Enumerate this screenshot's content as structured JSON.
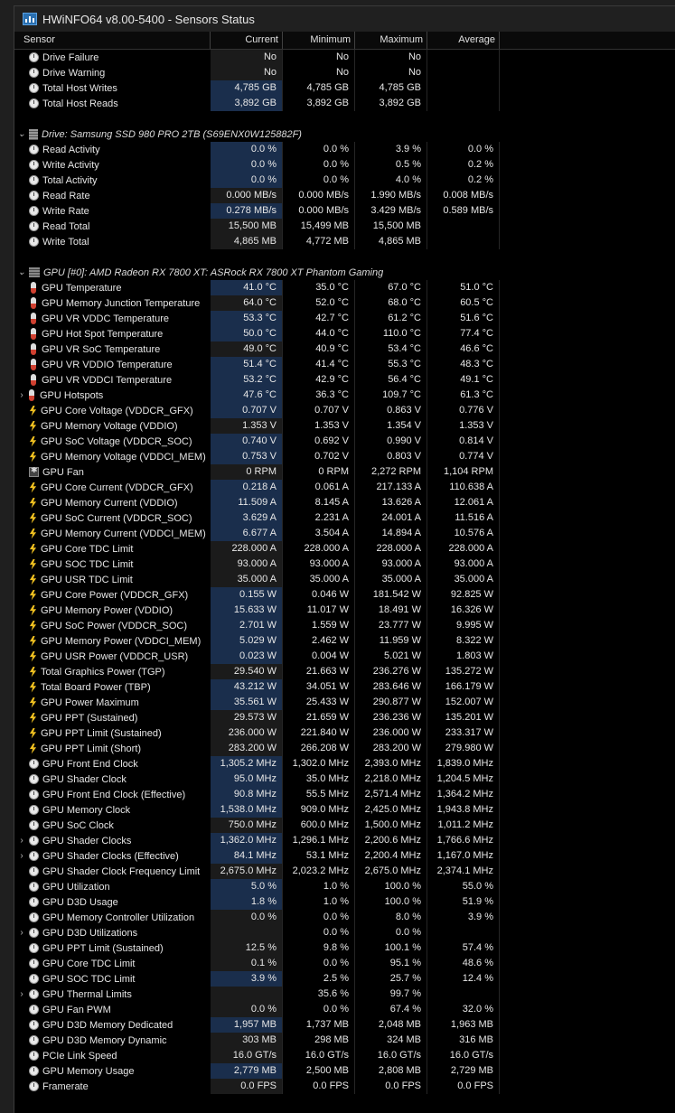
{
  "window": {
    "title": "HWiNFO64 v8.00-5400 - Sensors Status"
  },
  "columns": [
    "Sensor",
    "Current",
    "Minimum",
    "Maximum",
    "Average"
  ],
  "top_rows": [
    {
      "icon": "clock-icon",
      "label": "Drive Failure",
      "cur": "No",
      "min": "No",
      "max": "No",
      "avg": "",
      "hl": false
    },
    {
      "icon": "clock-icon",
      "label": "Drive Warning",
      "cur": "No",
      "min": "No",
      "max": "No",
      "avg": "",
      "hl": false
    },
    {
      "icon": "clock-icon",
      "label": "Total Host Writes",
      "cur": "4,785 GB",
      "min": "4,785 GB",
      "max": "4,785 GB",
      "avg": "",
      "hl": true
    },
    {
      "icon": "clock-icon",
      "label": "Total Host Reads",
      "cur": "3,892 GB",
      "min": "3,892 GB",
      "max": "3,892 GB",
      "avg": "",
      "hl": true
    }
  ],
  "drive_group": {
    "label": "Drive: Samsung SSD 980 PRO 2TB (S69ENX0W125882F)"
  },
  "drive_rows": [
    {
      "icon": "clock-icon",
      "label": "Read Activity",
      "cur": "0.0 %",
      "min": "0.0 %",
      "max": "3.9 %",
      "avg": "0.0 %",
      "hl": true
    },
    {
      "icon": "clock-icon",
      "label": "Write Activity",
      "cur": "0.0 %",
      "min": "0.0 %",
      "max": "0.5 %",
      "avg": "0.2 %",
      "hl": true
    },
    {
      "icon": "clock-icon",
      "label": "Total Activity",
      "cur": "0.0 %",
      "min": "0.0 %",
      "max": "4.0 %",
      "avg": "0.2 %",
      "hl": true
    },
    {
      "icon": "clock-icon",
      "label": "Read Rate",
      "cur": "0.000 MB/s",
      "min": "0.000 MB/s",
      "max": "1.990 MB/s",
      "avg": "0.008 MB/s",
      "hl": false
    },
    {
      "icon": "clock-icon",
      "label": "Write Rate",
      "cur": "0.278 MB/s",
      "min": "0.000 MB/s",
      "max": "3.429 MB/s",
      "avg": "0.589 MB/s",
      "hl": true
    },
    {
      "icon": "clock-icon",
      "label": "Read Total",
      "cur": "15,500 MB",
      "min": "15,499 MB",
      "max": "15,500 MB",
      "avg": "",
      "hl": false
    },
    {
      "icon": "clock-icon",
      "label": "Write Total",
      "cur": "4,865 MB",
      "min": "4,772 MB",
      "max": "4,865 MB",
      "avg": "",
      "hl": false
    }
  ],
  "gpu_group": {
    "label": "GPU [#0]: AMD Radeon RX 7800 XT: ASRock RX 7800 XT Phantom Gaming"
  },
  "gpu_rows": [
    {
      "icon": "thermometer-icon",
      "label": "GPU Temperature",
      "cur": "41.0 °C",
      "min": "35.0 °C",
      "max": "67.0 °C",
      "avg": "51.0 °C",
      "hl": true
    },
    {
      "icon": "thermometer-icon",
      "label": "GPU Memory Junction Temperature",
      "cur": "64.0 °C",
      "min": "52.0 °C",
      "max": "68.0 °C",
      "avg": "60.5 °C",
      "hl": false
    },
    {
      "icon": "thermometer-icon",
      "label": "GPU VR VDDC Temperature",
      "cur": "53.3 °C",
      "min": "42.7 °C",
      "max": "61.2 °C",
      "avg": "51.6 °C",
      "hl": true
    },
    {
      "icon": "thermometer-icon",
      "label": "GPU Hot Spot Temperature",
      "cur": "50.0 °C",
      "min": "44.0 °C",
      "max": "110.0 °C",
      "avg": "77.4 °C",
      "hl": true
    },
    {
      "icon": "thermometer-icon",
      "label": "GPU VR SoC Temperature",
      "cur": "49.0 °C",
      "min": "40.9 °C",
      "max": "53.4 °C",
      "avg": "46.6 °C",
      "hl": false
    },
    {
      "icon": "thermometer-icon",
      "label": "GPU VR VDDIO Temperature",
      "cur": "51.4 °C",
      "min": "41.4 °C",
      "max": "55.3 °C",
      "avg": "48.3 °C",
      "hl": true
    },
    {
      "icon": "thermometer-icon",
      "label": "GPU VR VDDCI Temperature",
      "cur": "53.2 °C",
      "min": "42.9 °C",
      "max": "56.4 °C",
      "avg": "49.1 °C",
      "hl": true
    },
    {
      "icon": "thermometer-icon",
      "label": "GPU Hotspots",
      "cur": "47.6 °C",
      "min": "36.3 °C",
      "max": "109.7 °C",
      "avg": "61.3 °C",
      "hl": true,
      "expand": true
    },
    {
      "icon": "voltage-icon",
      "label": "GPU Core Voltage (VDDCR_GFX)",
      "cur": "0.707 V",
      "min": "0.707 V",
      "max": "0.863 V",
      "avg": "0.776 V",
      "hl": true
    },
    {
      "icon": "voltage-icon",
      "label": "GPU Memory Voltage (VDDIO)",
      "cur": "1.353 V",
      "min": "1.353 V",
      "max": "1.354 V",
      "avg": "1.353 V",
      "hl": false
    },
    {
      "icon": "voltage-icon",
      "label": "GPU SoC Voltage (VDDCR_SOC)",
      "cur": "0.740 V",
      "min": "0.692 V",
      "max": "0.990 V",
      "avg": "0.814 V",
      "hl": true
    },
    {
      "icon": "voltage-icon",
      "label": "GPU Memory Voltage (VDDCI_MEM)",
      "cur": "0.753 V",
      "min": "0.702 V",
      "max": "0.803 V",
      "avg": "0.774 V",
      "hl": true
    },
    {
      "icon": "fan-icon",
      "label": "GPU Fan",
      "cur": "0 RPM",
      "min": "0 RPM",
      "max": "2,272 RPM",
      "avg": "1,104 RPM",
      "hl": false
    },
    {
      "icon": "voltage-icon",
      "label": "GPU Core Current (VDDCR_GFX)",
      "cur": "0.218 A",
      "min": "0.061 A",
      "max": "217.133 A",
      "avg": "110.638 A",
      "hl": true
    },
    {
      "icon": "voltage-icon",
      "label": "GPU Memory Current (VDDIO)",
      "cur": "11.509 A",
      "min": "8.145 A",
      "max": "13.626 A",
      "avg": "12.061 A",
      "hl": true
    },
    {
      "icon": "voltage-icon",
      "label": "GPU SoC Current (VDDCR_SOC)",
      "cur": "3.629 A",
      "min": "2.231 A",
      "max": "24.001 A",
      "avg": "11.516 A",
      "hl": true
    },
    {
      "icon": "voltage-icon",
      "label": "GPU Memory Current (VDDCI_MEM)",
      "cur": "6.677 A",
      "min": "3.504 A",
      "max": "14.894 A",
      "avg": "10.576 A",
      "hl": true
    },
    {
      "icon": "voltage-icon",
      "label": "GPU Core TDC Limit",
      "cur": "228.000 A",
      "min": "228.000 A",
      "max": "228.000 A",
      "avg": "228.000 A",
      "hl": false
    },
    {
      "icon": "voltage-icon",
      "label": "GPU SOC TDC Limit",
      "cur": "93.000 A",
      "min": "93.000 A",
      "max": "93.000 A",
      "avg": "93.000 A",
      "hl": false
    },
    {
      "icon": "voltage-icon",
      "label": "GPU USR TDC Limit",
      "cur": "35.000 A",
      "min": "35.000 A",
      "max": "35.000 A",
      "avg": "35.000 A",
      "hl": false
    },
    {
      "icon": "voltage-icon",
      "label": "GPU Core Power (VDDCR_GFX)",
      "cur": "0.155 W",
      "min": "0.046 W",
      "max": "181.542 W",
      "avg": "92.825 W",
      "hl": true
    },
    {
      "icon": "voltage-icon",
      "label": "GPU Memory Power (VDDIO)",
      "cur": "15.633 W",
      "min": "11.017 W",
      "max": "18.491 W",
      "avg": "16.326 W",
      "hl": true
    },
    {
      "icon": "voltage-icon",
      "label": "GPU SoC Power (VDDCR_SOC)",
      "cur": "2.701 W",
      "min": "1.559 W",
      "max": "23.777 W",
      "avg": "9.995 W",
      "hl": true
    },
    {
      "icon": "voltage-icon",
      "label": "GPU Memory Power (VDDCI_MEM)",
      "cur": "5.029 W",
      "min": "2.462 W",
      "max": "11.959 W",
      "avg": "8.322 W",
      "hl": true
    },
    {
      "icon": "voltage-icon",
      "label": "GPU USR Power (VDDCR_USR)",
      "cur": "0.023 W",
      "min": "0.004 W",
      "max": "5.021 W",
      "avg": "1.803 W",
      "hl": true
    },
    {
      "icon": "voltage-icon",
      "label": "Total Graphics Power (TGP)",
      "cur": "29.540 W",
      "min": "21.663 W",
      "max": "236.276 W",
      "avg": "135.272 W",
      "hl": false
    },
    {
      "icon": "voltage-icon",
      "label": "Total Board Power (TBP)",
      "cur": "43.212 W",
      "min": "34.051 W",
      "max": "283.646 W",
      "avg": "166.179 W",
      "hl": true
    },
    {
      "icon": "voltage-icon",
      "label": "GPU Power Maximum",
      "cur": "35.561 W",
      "min": "25.433 W",
      "max": "290.877 W",
      "avg": "152.007 W",
      "hl": true
    },
    {
      "icon": "voltage-icon",
      "label": "GPU PPT (Sustained)",
      "cur": "29.573 W",
      "min": "21.659 W",
      "max": "236.236 W",
      "avg": "135.201 W",
      "hl": false
    },
    {
      "icon": "voltage-icon",
      "label": "GPU PPT Limit (Sustained)",
      "cur": "236.000 W",
      "min": "221.840 W",
      "max": "236.000 W",
      "avg": "233.317 W",
      "hl": false
    },
    {
      "icon": "voltage-icon",
      "label": "GPU PPT Limit (Short)",
      "cur": "283.200 W",
      "min": "266.208 W",
      "max": "283.200 W",
      "avg": "279.980 W",
      "hl": false
    },
    {
      "icon": "clock-icon",
      "label": "GPU Front End Clock",
      "cur": "1,305.2 MHz",
      "min": "1,302.0 MHz",
      "max": "2,393.0 MHz",
      "avg": "1,839.0 MHz",
      "hl": true
    },
    {
      "icon": "clock-icon",
      "label": "GPU Shader Clock",
      "cur": "95.0 MHz",
      "min": "35.0 MHz",
      "max": "2,218.0 MHz",
      "avg": "1,204.5 MHz",
      "hl": true
    },
    {
      "icon": "clock-icon",
      "label": "GPU Front End Clock (Effective)",
      "cur": "90.8 MHz",
      "min": "55.5 MHz",
      "max": "2,571.4 MHz",
      "avg": "1,364.2 MHz",
      "hl": true
    },
    {
      "icon": "clock-icon",
      "label": "GPU Memory Clock",
      "cur": "1,538.0 MHz",
      "min": "909.0 MHz",
      "max": "2,425.0 MHz",
      "avg": "1,943.8 MHz",
      "hl": true
    },
    {
      "icon": "clock-icon",
      "label": "GPU SoC Clock",
      "cur": "750.0 MHz",
      "min": "600.0 MHz",
      "max": "1,500.0 MHz",
      "avg": "1,011.2 MHz",
      "hl": false
    },
    {
      "icon": "clock-icon",
      "label": "GPU Shader Clocks",
      "cur": "1,362.0 MHz",
      "min": "1,296.1 MHz",
      "max": "2,200.6 MHz",
      "avg": "1,766.6 MHz",
      "hl": true,
      "expand": true
    },
    {
      "icon": "clock-icon",
      "label": "GPU Shader Clocks (Effective)",
      "cur": "84.1 MHz",
      "min": "53.1 MHz",
      "max": "2,200.4 MHz",
      "avg": "1,167.0 MHz",
      "hl": true,
      "expand": true
    },
    {
      "icon": "clock-icon",
      "label": "GPU Shader Clock Frequency Limit",
      "cur": "2,675.0 MHz",
      "min": "2,023.2 MHz",
      "max": "2,675.0 MHz",
      "avg": "2,374.1 MHz",
      "hl": false
    },
    {
      "icon": "clock-icon",
      "label": "GPU Utilization",
      "cur": "5.0 %",
      "min": "1.0 %",
      "max": "100.0 %",
      "avg": "55.0 %",
      "hl": true
    },
    {
      "icon": "clock-icon",
      "label": "GPU D3D Usage",
      "cur": "1.8 %",
      "min": "1.0 %",
      "max": "100.0 %",
      "avg": "51.9 %",
      "hl": true
    },
    {
      "icon": "clock-icon",
      "label": "GPU Memory Controller Utilization",
      "cur": "0.0 %",
      "min": "0.0 %",
      "max": "8.0 %",
      "avg": "3.9 %",
      "hl": false
    },
    {
      "icon": "clock-icon",
      "label": "GPU D3D Utilizations",
      "cur": "",
      "min": "0.0 %",
      "max": "0.0 %",
      "avg": "",
      "hl": false,
      "expand": true
    },
    {
      "icon": "clock-icon",
      "label": "GPU PPT Limit (Sustained)",
      "cur": "12.5 %",
      "min": "9.8 %",
      "max": "100.1 %",
      "avg": "57.4 %",
      "hl": false
    },
    {
      "icon": "clock-icon",
      "label": "GPU Core TDC Limit",
      "cur": "0.1 %",
      "min": "0.0 %",
      "max": "95.1 %",
      "avg": "48.6 %",
      "hl": false
    },
    {
      "icon": "clock-icon",
      "label": "GPU SOC TDC Limit",
      "cur": "3.9 %",
      "min": "2.5 %",
      "max": "25.7 %",
      "avg": "12.4 %",
      "hl": true
    },
    {
      "icon": "clock-icon",
      "label": "GPU Thermal Limits",
      "cur": "",
      "min": "35.6 %",
      "max": "99.7 %",
      "avg": "",
      "hl": false,
      "expand": true
    },
    {
      "icon": "clock-icon",
      "label": "GPU Fan PWM",
      "cur": "0.0 %",
      "min": "0.0 %",
      "max": "67.4 %",
      "avg": "32.0 %",
      "hl": false
    },
    {
      "icon": "clock-icon",
      "label": "GPU D3D Memory Dedicated",
      "cur": "1,957 MB",
      "min": "1,737 MB",
      "max": "2,048 MB",
      "avg": "1,963 MB",
      "hl": true
    },
    {
      "icon": "clock-icon",
      "label": "GPU D3D Memory Dynamic",
      "cur": "303 MB",
      "min": "298 MB",
      "max": "324 MB",
      "avg": "316 MB",
      "hl": false
    },
    {
      "icon": "clock-icon",
      "label": "PCIe Link Speed",
      "cur": "16.0 GT/s",
      "min": "16.0 GT/s",
      "max": "16.0 GT/s",
      "avg": "16.0 GT/s",
      "hl": false
    },
    {
      "icon": "clock-icon",
      "label": "GPU Memory Usage",
      "cur": "2,779 MB",
      "min": "2,500 MB",
      "max": "2,808 MB",
      "avg": "2,729 MB",
      "hl": true
    },
    {
      "icon": "clock-icon",
      "label": "Framerate",
      "cur": "0.0 FPS",
      "min": "0.0 FPS",
      "max": "0.0 FPS",
      "avg": "0.0 FPS",
      "hl": false
    }
  ]
}
